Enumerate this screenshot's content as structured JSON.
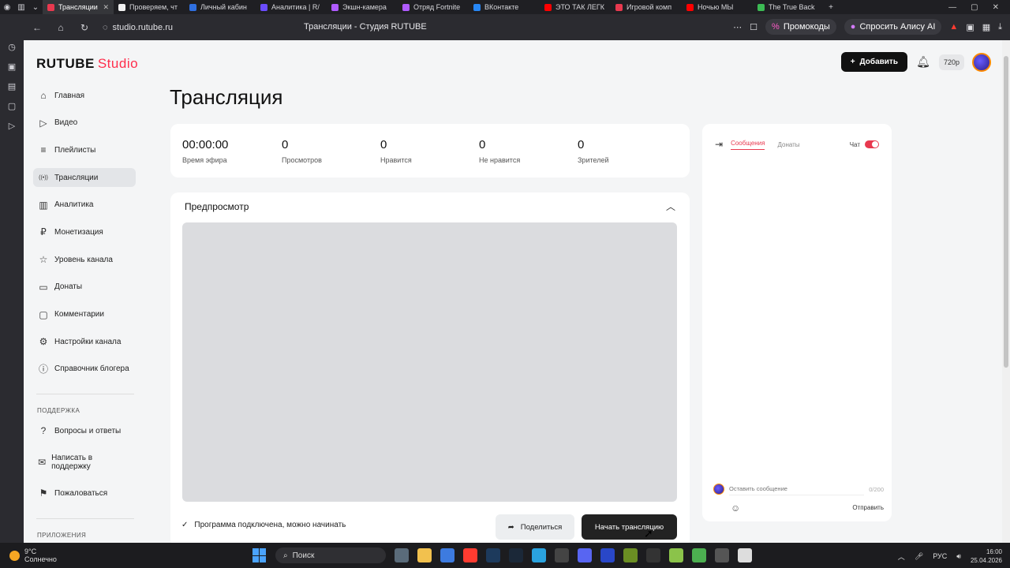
{
  "browser": {
    "tabs": [
      {
        "title": "Трансляции",
        "color": "#e8394f",
        "active": true
      },
      {
        "title": "Проверяем, чт",
        "color": "#f2f2f2"
      },
      {
        "title": "Личный кабин",
        "color": "#2f6fe0"
      },
      {
        "title": "Аналитика | R/",
        "color": "#6b4cff"
      },
      {
        "title": "Экшн-камера",
        "color": "#b05bff"
      },
      {
        "title": "Отряд Fortnite",
        "color": "#b05bff"
      },
      {
        "title": "ВКонтакте",
        "color": "#2787f5"
      },
      {
        "title": "ЭТО ТАК ЛЕГК",
        "color": "#ff0000"
      },
      {
        "title": "Игровой комп",
        "color": "#e8394f"
      },
      {
        "title": "Ночью МЫ",
        "color": "#ff0000"
      },
      {
        "title": "The True Back",
        "color": "#3cba54"
      }
    ],
    "url": "studio.rutube.ru",
    "page_title": "Трансляции - Студия RUTUBE",
    "promo_label": "Промокоды",
    "alice_label": "Спросить Алису AI"
  },
  "logo": {
    "brand": "RUTUBE",
    "suffix": "Studio"
  },
  "sidebar": {
    "items": [
      {
        "label": "Главная",
        "icon": "home-icon"
      },
      {
        "label": "Видео",
        "icon": "video-icon"
      },
      {
        "label": "Плейлисты",
        "icon": "playlist-icon"
      },
      {
        "label": "Трансляции",
        "icon": "broadcast-icon",
        "active": true
      },
      {
        "label": "Аналитика",
        "icon": "chart-icon"
      },
      {
        "label": "Монетизация",
        "icon": "ruble-icon"
      },
      {
        "label": "Уровень канала",
        "icon": "star-icon"
      },
      {
        "label": "Донаты",
        "icon": "wallet-icon"
      },
      {
        "label": "Комментарии",
        "icon": "comment-icon"
      },
      {
        "label": "Настройки канала",
        "icon": "gear-icon"
      },
      {
        "label": "Справочник блогера",
        "icon": "info-icon"
      }
    ],
    "support_label": "ПОДДЕРЖКА",
    "support_items": [
      {
        "label": "Вопросы и ответы",
        "icon": "question-icon"
      },
      {
        "label": "Написать в поддержку",
        "icon": "mail-icon"
      },
      {
        "label": "Пожаловаться",
        "icon": "flag-icon"
      }
    ],
    "apps_label": "ПРИЛОЖЕНИЯ"
  },
  "header": {
    "add_label": "Добавить",
    "quality": "720p"
  },
  "main": {
    "title": "Трансляция",
    "stats": [
      {
        "value": "00:00:00",
        "label": "Время эфира"
      },
      {
        "value": "0",
        "label": "Просмотров"
      },
      {
        "value": "0",
        "label": "Нравится"
      },
      {
        "value": "0",
        "label": "Не нравится"
      },
      {
        "value": "0",
        "label": "Зрителей"
      }
    ],
    "preview_title": "Предпросмотр",
    "status_text": "Программа подключена, можно начинать",
    "share_label": "Поделиться",
    "start_label": "Начать трансляцию"
  },
  "chat": {
    "tab_messages": "Сообщения",
    "tab_donations": "Донаты",
    "chat_label": "Чат",
    "chat_enabled": true,
    "placeholder": "Оставить сообщение",
    "counter": "0/200",
    "send_label": "Отправить"
  },
  "taskbar": {
    "temp": "9°C",
    "weather": "Солнечно",
    "search": "Поиск",
    "lang": "РУС",
    "time": "16:00",
    "date": "25.04.2026"
  }
}
